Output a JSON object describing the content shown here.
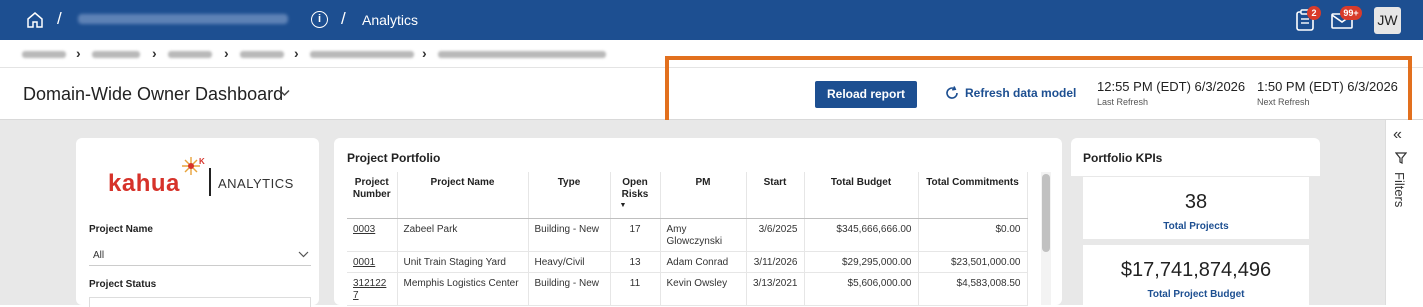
{
  "topbar": {
    "crumb_title": "Analytics",
    "info_glyph": "i",
    "notifications_badge": "2",
    "mail_badge": "99+",
    "avatar_initials": "JW",
    "accent": "#1d4f91"
  },
  "header": {
    "dashboard_title": "Domain-Wide Owner Dashboard",
    "reload_label": "Reload report",
    "refresh_label": "Refresh data model",
    "last_refresh_time": "12:55 PM (EDT) 6/3/2026",
    "last_refresh_label": "Last Refresh",
    "next_refresh_time": "1:50 PM (EDT) 6/3/2026",
    "next_refresh_label": "Next Refresh",
    "highlight_color": "#e2701e"
  },
  "filters_rail": {
    "label": "Filters"
  },
  "left_panel": {
    "logo_text": "kahua",
    "logo_suffix": "ANALYTICS",
    "project_name_label": "Project Name",
    "project_name_value": "All",
    "project_status_label": "Project Status"
  },
  "portfolio": {
    "title": "Project Portfolio",
    "columns": [
      "Project Number",
      "Project Name",
      "Type",
      "Open Risks",
      "PM",
      "Start",
      "Total Budget",
      "Total Commitments"
    ],
    "rows": [
      [
        "0003",
        "Zabeel Park",
        "Building - New",
        "17",
        "Amy Glowczynski",
        "3/6/2025",
        "$345,666,666.00",
        "$0.00"
      ],
      [
        "0001",
        "Unit Train Staging Yard",
        "Heavy/Civil",
        "13",
        "Adam Conrad",
        "3/11/2026",
        "$29,295,000.00",
        "$23,501,000.00"
      ],
      [
        "3121227",
        "Memphis Logistics Center",
        "Building - New",
        "11",
        "Kevin Owsley",
        "3/13/2021",
        "$5,606,000.00",
        "$4,583,008.50"
      ]
    ]
  },
  "kpis": {
    "title": "Portfolio KPIs",
    "total_projects_value": "38",
    "total_projects_label": "Total Projects",
    "total_budget_value": "$17,741,874,496",
    "total_budget_label": "Total Project Budget"
  }
}
